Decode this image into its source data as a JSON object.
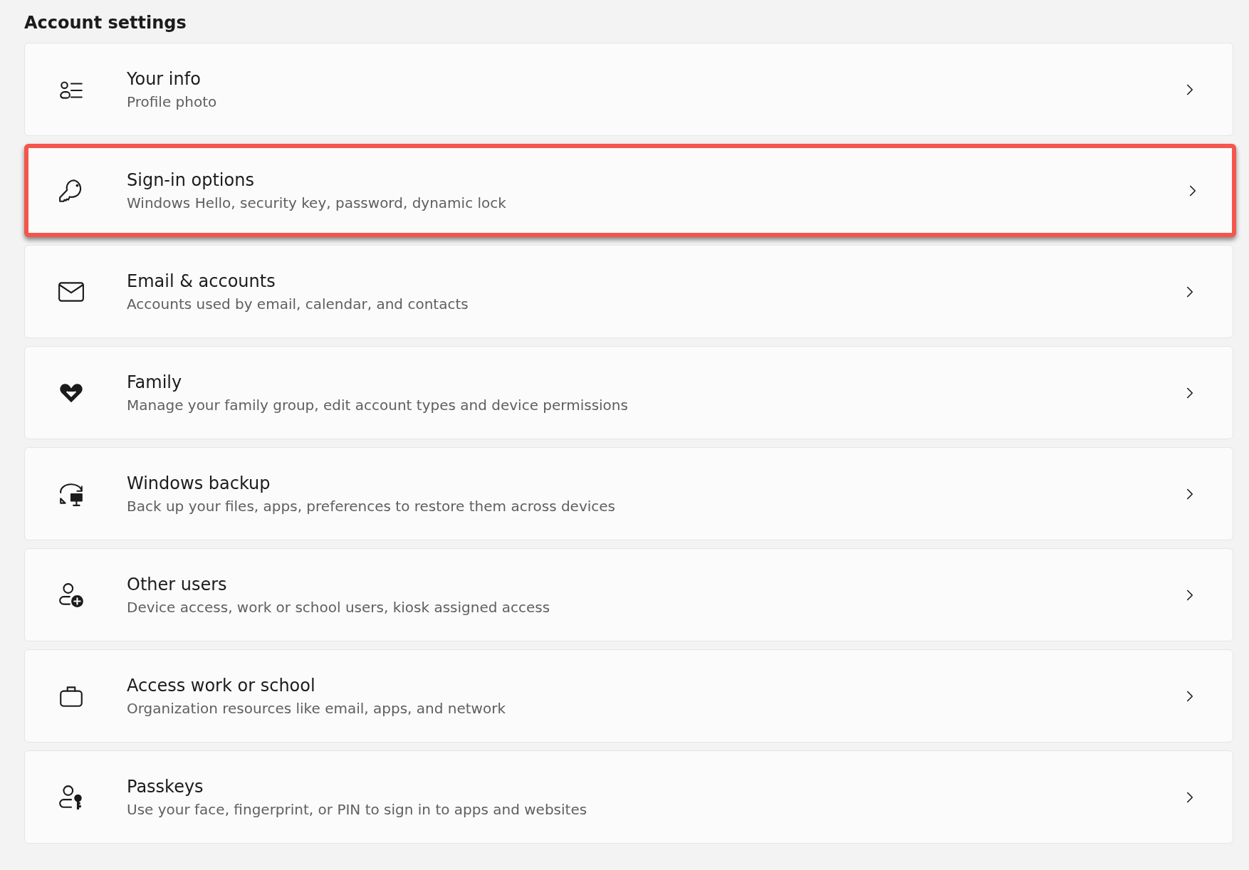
{
  "heading": "Account settings",
  "items": [
    {
      "title": "Your info",
      "subtitle": "Profile photo",
      "highlighted": false
    },
    {
      "title": "Sign-in options",
      "subtitle": "Windows Hello, security key, password, dynamic lock",
      "highlighted": true
    },
    {
      "title": "Email & accounts",
      "subtitle": "Accounts used by email, calendar, and contacts",
      "highlighted": false
    },
    {
      "title": "Family",
      "subtitle": "Manage your family group, edit account types and device permissions",
      "highlighted": false
    },
    {
      "title": "Windows backup",
      "subtitle": "Back up your files, apps, preferences to restore them across devices",
      "highlighted": false
    },
    {
      "title": "Other users",
      "subtitle": "Device access, work or school users, kiosk assigned access",
      "highlighted": false
    },
    {
      "title": "Access work or school",
      "subtitle": "Organization resources like email, apps, and network",
      "highlighted": false
    },
    {
      "title": "Passkeys",
      "subtitle": "Use your face, fingerprint, or PIN to sign in to apps and websites",
      "highlighted": false
    }
  ]
}
